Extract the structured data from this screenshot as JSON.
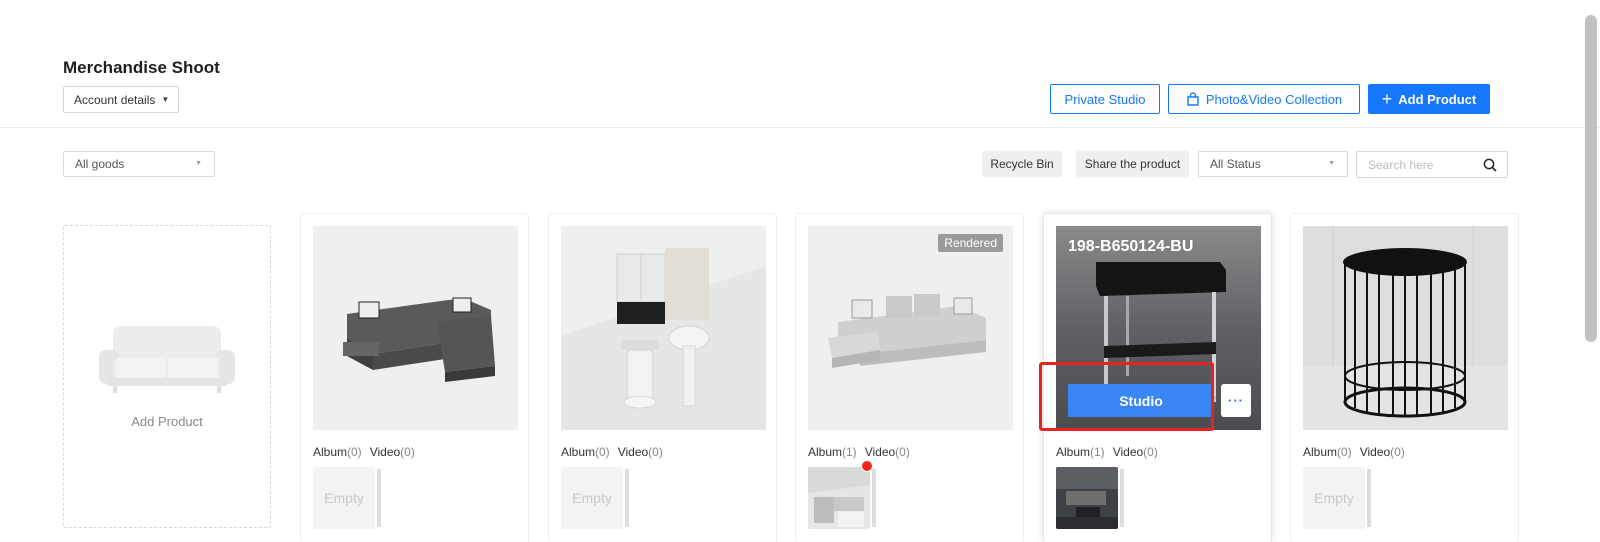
{
  "header": {
    "title": "Merchandise Shoot",
    "account_label": "Account details",
    "private_studio_label": "Private Studio",
    "collection_label": "Photo&Video Collection",
    "add_product_label": "Add Product",
    "accent_color": "#1677ff"
  },
  "toolbar": {
    "goods_filter": "All goods",
    "recycle_bin_label": "Recycle Bin",
    "share_label": "Share the product",
    "status_filter": "All Status",
    "search_placeholder": "Search here"
  },
  "add_card": {
    "label": "Add Product"
  },
  "products": [
    {
      "album_label": "Album",
      "album_count": "(0)",
      "video_label": "Video",
      "video_count": "(0)",
      "empty_label": "Empty"
    },
    {
      "album_label": "Album",
      "album_count": "(0)",
      "video_label": "Video",
      "video_count": "(0)",
      "empty_label": "Empty"
    },
    {
      "badge": "Rendered",
      "album_label": "Album",
      "album_count": "(1)",
      "video_label": "Video",
      "video_count": "(0)"
    },
    {
      "sku": "198-B650124-BU",
      "studio_label": "Studio",
      "more_label": "···",
      "album_label": "Album",
      "album_count": "(1)",
      "video_label": "Video",
      "video_count": "(0)"
    },
    {
      "album_label": "Album",
      "album_count": "(0)",
      "video_label": "Video",
      "video_count": "(0)",
      "empty_label": "Empty"
    }
  ]
}
